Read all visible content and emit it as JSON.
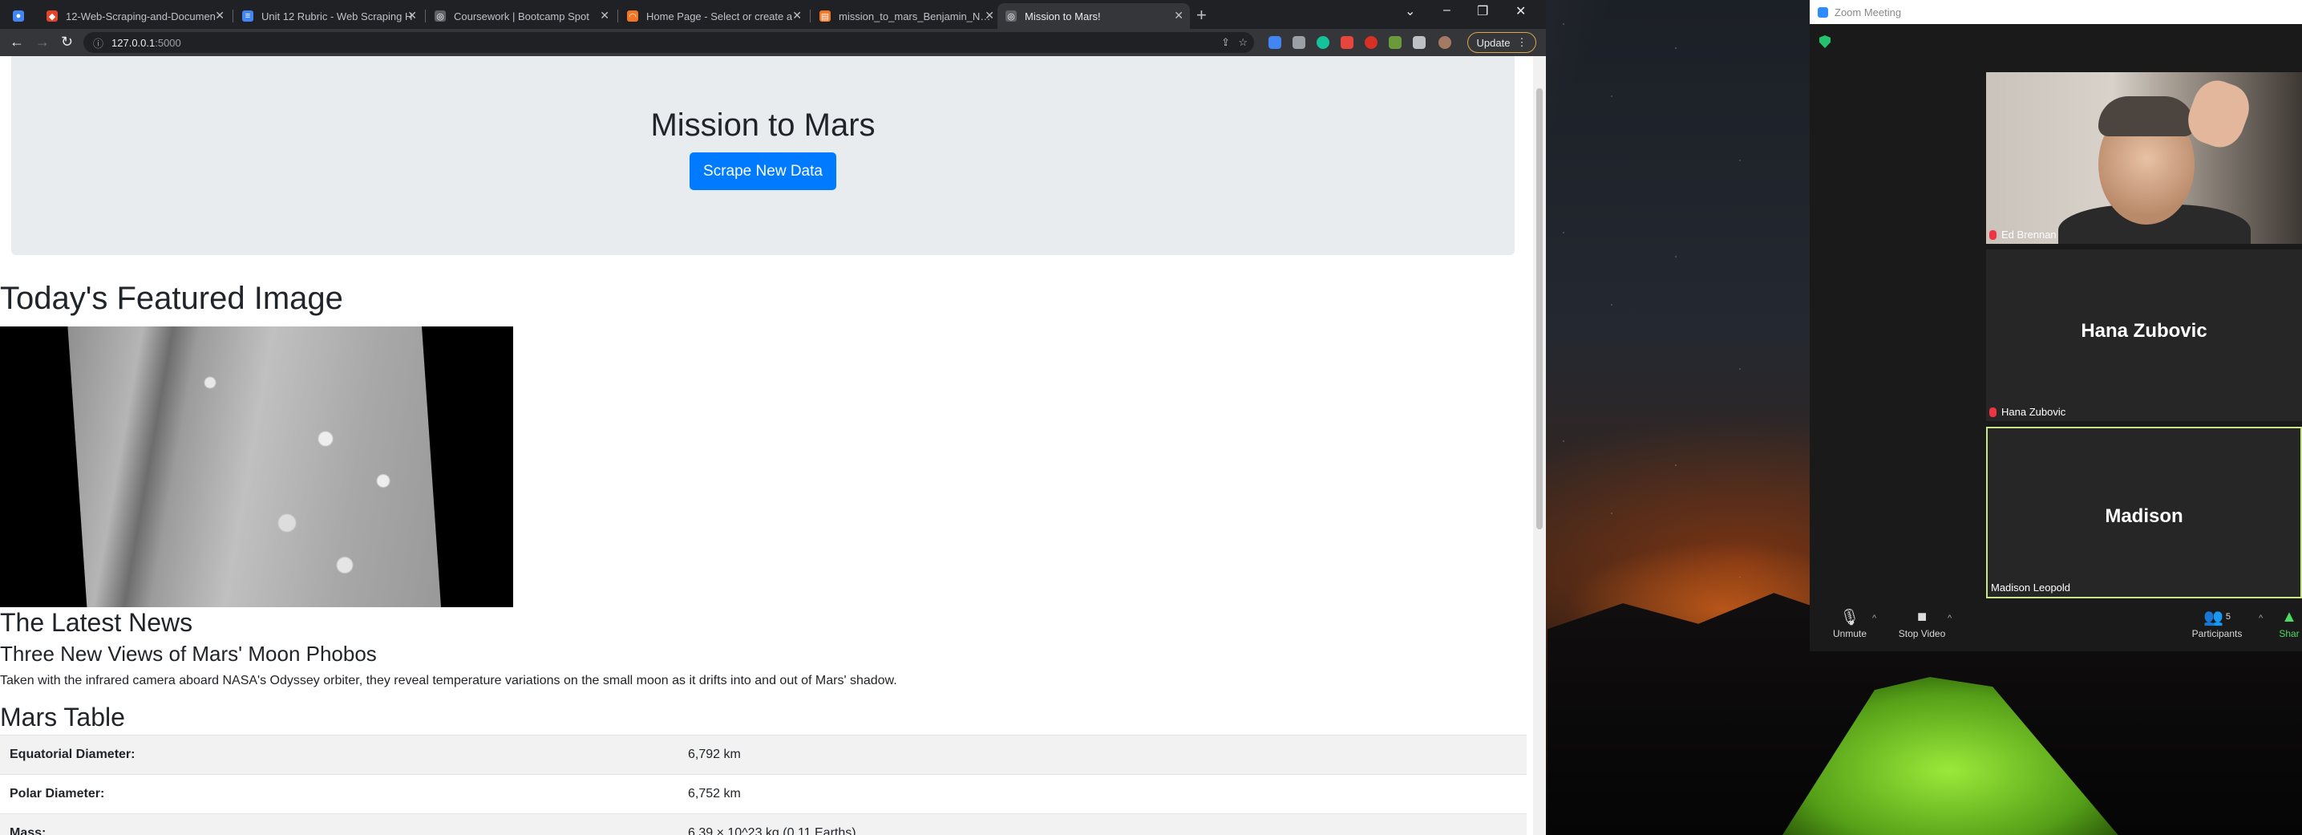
{
  "browser": {
    "tabs": [
      {
        "label": "",
        "icon": "chrome-icon"
      },
      {
        "label": "12-Web-Scraping-and-Documen",
        "icon": "gitlab-icon"
      },
      {
        "label": "Unit 12 Rubric - Web Scraping H",
        "icon": "docs-icon"
      },
      {
        "label": "Coursework | Bootcamp Spot",
        "icon": "globe-icon"
      },
      {
        "label": "Home Page - Select or create a",
        "icon": "jupyter-icon"
      },
      {
        "label": "mission_to_mars_Benjamin_Ngu",
        "icon": "notebook-icon"
      },
      {
        "label": "Mission to Mars!",
        "icon": "globe-icon"
      }
    ],
    "url_host": "127.0.0.1",
    "url_port": ":5000",
    "update_label": "Update"
  },
  "page": {
    "title": "Mission to Mars",
    "scrape_button": "Scrape New Data",
    "featured_heading": "Today's Featured Image",
    "news_heading": "The Latest News",
    "news_title": "Three New Views of Mars' Moon Phobos",
    "news_body": "Taken with the infrared camera aboard NASA's Odyssey orbiter, they reveal temperature variations on the small moon as it drifts into and out of Mars' shadow.",
    "table_heading": "Mars Table",
    "table_rows": [
      {
        "key": "Equatorial Diameter:",
        "value": "6,792 km"
      },
      {
        "key": "Polar Diameter:",
        "value": "6,752 km"
      },
      {
        "key": "Mass:",
        "value": "6.39 × 10^23 kg (0.11 Earths)"
      }
    ]
  },
  "zoom": {
    "window_title": "Zoom Meeting",
    "participants": [
      {
        "name": "Ed Brennan",
        "display": ""
      },
      {
        "name": "Hana Zubovic",
        "display": "Hana Zubovic"
      },
      {
        "name": "Madison Leopold",
        "display": "Madison"
      }
    ],
    "controls": {
      "unmute": "Unmute",
      "stop_video": "Stop Video",
      "participants": "Participants",
      "participants_count": "5",
      "share": "Shar"
    }
  }
}
